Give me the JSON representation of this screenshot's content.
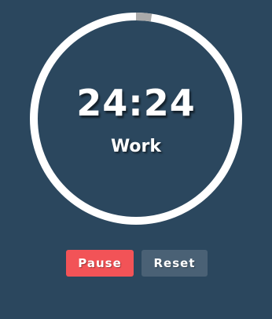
{
  "timer": {
    "time": "24:24",
    "mode": "Work",
    "progress_fraction": 0.024,
    "colors": {
      "ring": "#ffffff",
      "elapsed": "#aaaaaa",
      "background": "#2b475e"
    }
  },
  "controls": {
    "pause_label": "Pause",
    "reset_label": "Reset",
    "pause_color": "#f25357",
    "reset_color": "#4a6175"
  }
}
